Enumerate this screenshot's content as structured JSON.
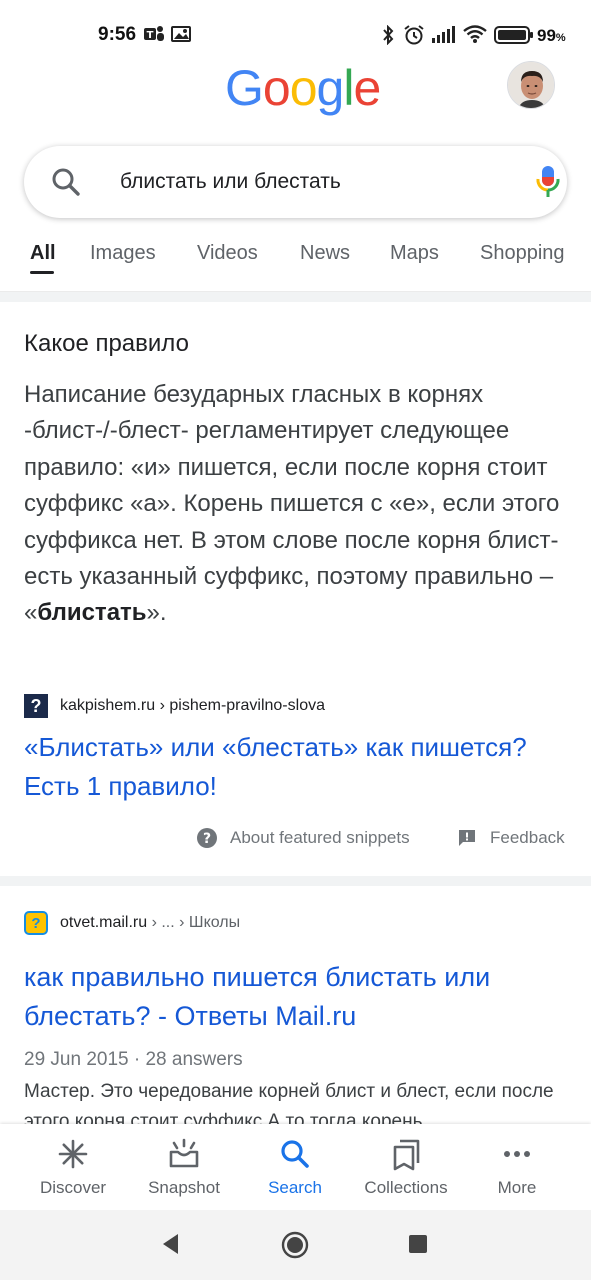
{
  "status_bar": {
    "time": "9:56",
    "battery_percent": "99",
    "battery_unit": "%"
  },
  "header": {
    "logo_letters": [
      {
        "char": "G",
        "color": "#4285F4"
      },
      {
        "char": "o",
        "color": "#EA4335"
      },
      {
        "char": "o",
        "color": "#FBBC05"
      },
      {
        "char": "g",
        "color": "#4285F4"
      },
      {
        "char": "l",
        "color": "#34A853"
      },
      {
        "char": "e",
        "color": "#EA4335"
      }
    ]
  },
  "search": {
    "query": "блистать или блестать"
  },
  "tabs": [
    {
      "label": "All",
      "active": true
    },
    {
      "label": "Images",
      "active": false
    },
    {
      "label": "Videos",
      "active": false
    },
    {
      "label": "News",
      "active": false
    },
    {
      "label": "Maps",
      "active": false
    },
    {
      "label": "Shopping",
      "active": false
    }
  ],
  "featured_snippet": {
    "heading": "Какое правило",
    "body_before_bold": "Написание безударных гласных в корнях -блист-/-блест- регламентирует следующее правило: «и» пишется, если после корня стоит суффикс «а». Корень пишется с «е», если этого суффикса нет. В этом слове после корня блист- есть указанный суффикс, поэтому правильно – «",
    "body_bold": "блистать",
    "body_after_bold": "».",
    "source_favicon": "?",
    "source": "kakpishem.ru › pishem-pravilno-slova",
    "link_title": "«Блистать» или «блестать» как пишется? Есть 1 правило!",
    "about_label": "About featured snippets",
    "feedback_label": "Feedback"
  },
  "result2": {
    "favicon": "?",
    "domain": "otvet.mail.ru",
    "crumbs": " › ... › Школы",
    "title": "как правильно пишется блистать или блестать? - Ответы Mail.ru",
    "meta": "29 Jun 2015 · 28 answers",
    "description": "Мастер. Это чередование корней блист и блест, если после этого корня стоит суффикс А то тогда корень"
  },
  "bottom_nav": [
    {
      "label": "Discover",
      "icon": "discover-asterisk-icon",
      "active": false
    },
    {
      "label": "Snapshot",
      "icon": "snapshot-icon",
      "active": false
    },
    {
      "label": "Search",
      "icon": "search-icon",
      "active": true
    },
    {
      "label": "Collections",
      "icon": "collections-icon",
      "active": false
    },
    {
      "label": "More",
      "icon": "more-dots-icon",
      "active": false
    }
  ],
  "colors": {
    "link": "#1558d6",
    "active_nav": "#1a73e8",
    "muted": "#70757a"
  }
}
